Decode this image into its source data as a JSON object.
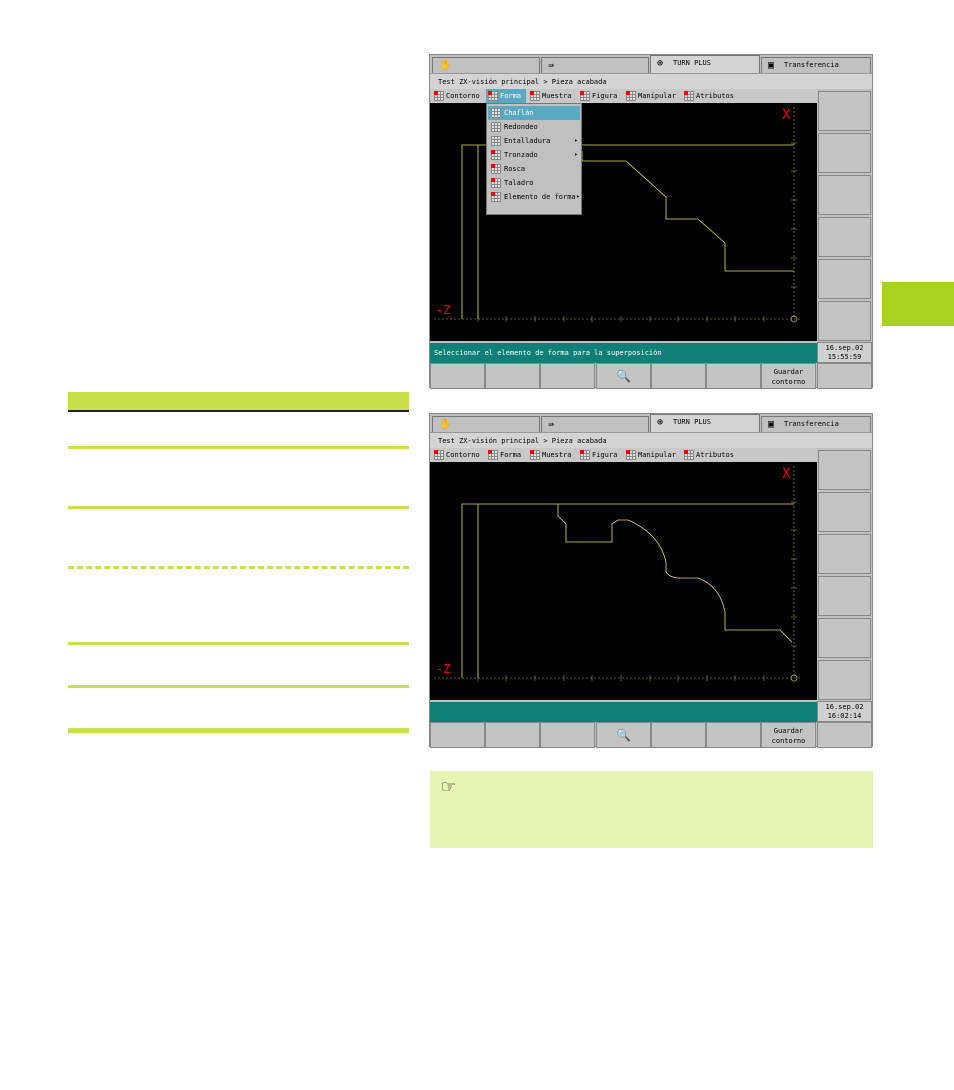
{
  "screen1": {
    "tabs": [
      {
        "icon": "hand-icon",
        "label": ""
      },
      {
        "icon": "arrow-right-icon",
        "label": ""
      },
      {
        "icon": "turn-plus-icon",
        "label": "TURN PLUS"
      },
      {
        "icon": "floppy-icon",
        "label": "Transferencia"
      }
    ],
    "path": "Test  ZX-visión principal > Pieza acabada",
    "menu": [
      "Contorno",
      "Forma",
      "Muestra",
      "Figura",
      "Manipular",
      "Atributos"
    ],
    "menu_selected": "Forma",
    "dropdown": [
      {
        "label": "Chaflán",
        "selected": true,
        "submenu": false
      },
      {
        "label": "Redondeo",
        "selected": false,
        "submenu": false
      },
      {
        "label": "Entalladura",
        "selected": false,
        "submenu": true
      },
      {
        "label": "Tronzado",
        "selected": false,
        "submenu": true
      },
      {
        "label": "Rosca",
        "selected": false,
        "submenu": false
      },
      {
        "label": "Taladro",
        "selected": false,
        "submenu": false
      },
      {
        "label": "Elemento de forma",
        "selected": false,
        "submenu": true
      }
    ],
    "status": "Seleccionar el elemento de forma para la superposición",
    "date": "16.sep.02",
    "time": "15:55:59",
    "save_button": [
      "Guardar",
      "contorno"
    ],
    "axis_x": "X",
    "axis_z": "-Z"
  },
  "screen2": {
    "tabs": [
      {
        "icon": "hand-icon",
        "label": ""
      },
      {
        "icon": "arrow-right-icon",
        "label": ""
      },
      {
        "icon": "turn-plus-icon",
        "label": "TURN PLUS"
      },
      {
        "icon": "floppy-icon",
        "label": "Transferencia"
      }
    ],
    "path": "Test  ZX-visión principal > Pieza acabada",
    "menu": [
      "Contorno",
      "Forma",
      "Muestra",
      "Figura",
      "Manipular",
      "Atributos"
    ],
    "status": "",
    "date": "16.sep.02",
    "time": "16:02:14",
    "save_button": [
      "Guardar",
      "contorno"
    ],
    "axis_x": "X",
    "axis_z": "-Z"
  },
  "colors": {
    "accent_green": "#a8d21e",
    "status_teal": "#0f8078",
    "contour_yellow": "#e8e05a",
    "note_bg": "#e6f4b4"
  }
}
